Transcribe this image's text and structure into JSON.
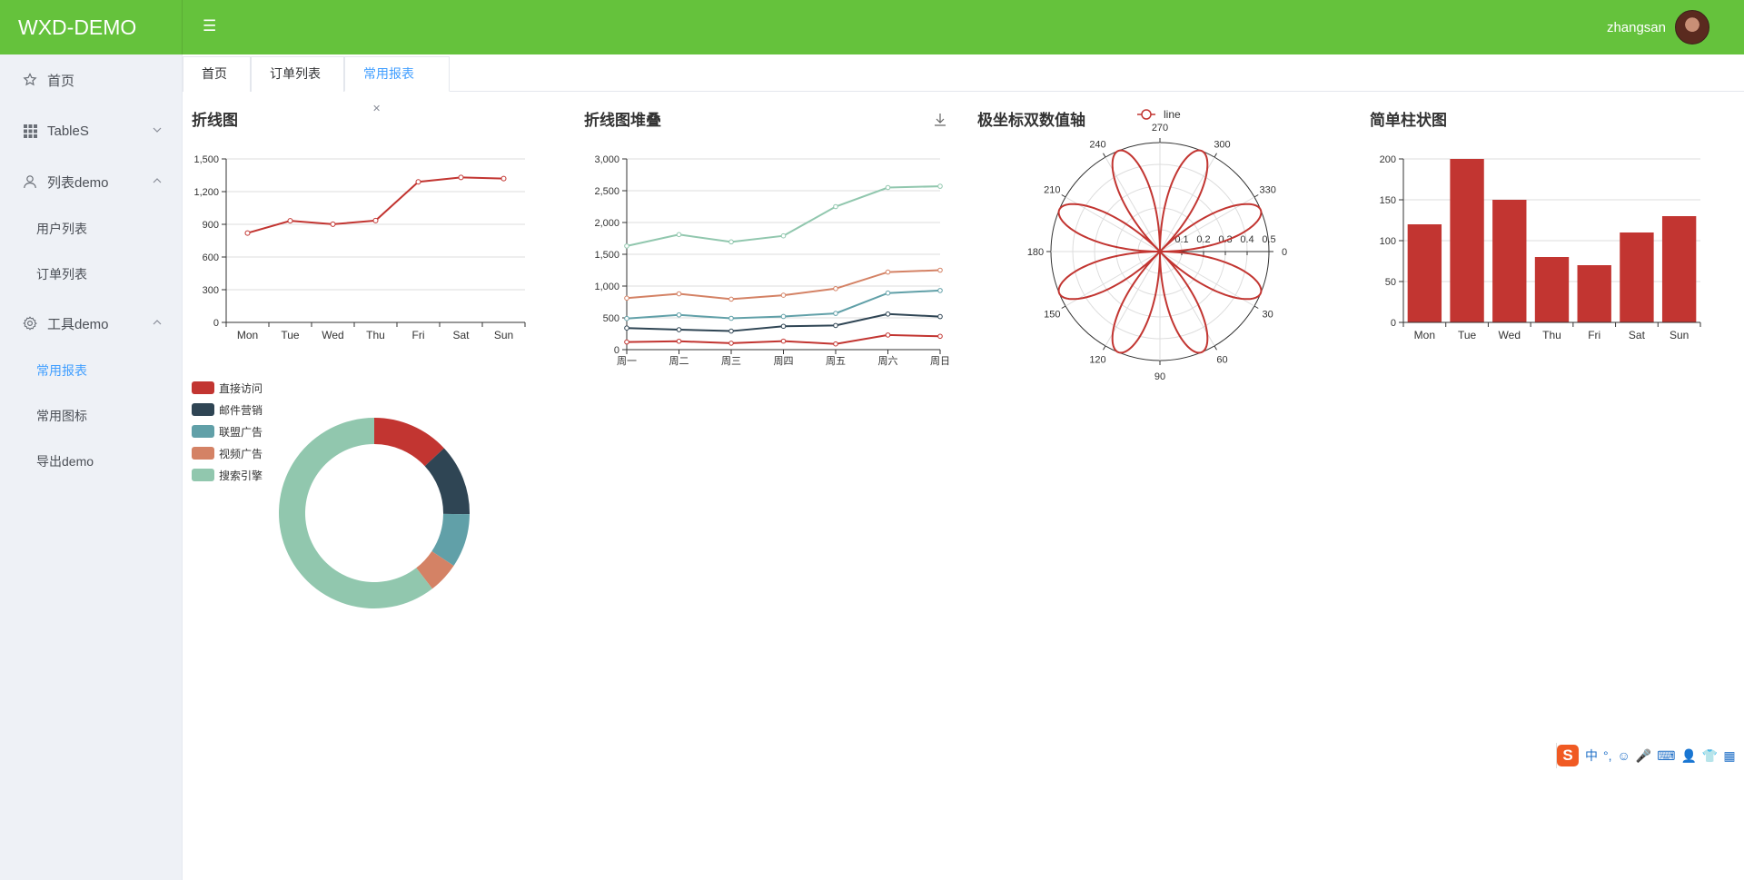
{
  "app": {
    "title": "WXD-DEMO",
    "user": "zhangsan"
  },
  "sidebar": {
    "home": "首页",
    "tables": "TableS",
    "list_demo": "列表demo",
    "list_children": [
      "用户列表",
      "订单列表"
    ],
    "tool_demo": "工具demo",
    "tool_children": [
      "常用报表",
      "常用图标",
      "导出demo"
    ],
    "active": "常用报表"
  },
  "tabs": [
    {
      "label": "首页"
    },
    {
      "label": "订单列表"
    },
    {
      "label": "常用报表",
      "active": true
    }
  ],
  "ime": {
    "items": [
      "中",
      "°,",
      "☺",
      "🎤",
      "⌨",
      "👤",
      "👕",
      "▦"
    ]
  },
  "chart_data": [
    {
      "type": "line",
      "title": "折线图",
      "categories": [
        "Mon",
        "Tue",
        "Wed",
        "Thu",
        "Fri",
        "Sat",
        "Sun"
      ],
      "values": [
        820,
        932,
        901,
        934,
        1290,
        1330,
        1320
      ],
      "ylim": [
        0,
        1500
      ],
      "yticks": [
        "0",
        "300",
        "600",
        "900",
        "1,200",
        "1,500"
      ],
      "color": "#c23531"
    },
    {
      "type": "line",
      "title": "折线图堆叠",
      "stacked": true,
      "categories": [
        "周一",
        "周二",
        "周三",
        "周四",
        "周五",
        "周六",
        "周日"
      ],
      "ylim": [
        0,
        3000
      ],
      "yticks": [
        "0",
        "500",
        "1,000",
        "1,500",
        "2,000",
        "2,500",
        "3,000"
      ],
      "series": [
        {
          "values": [
            120,
            132,
            101,
            134,
            90,
            230,
            210
          ],
          "color": "#c23531"
        },
        {
          "values": [
            220,
            182,
            191,
            234,
            290,
            330,
            310
          ],
          "color": "#2f4554"
        },
        {
          "values": [
            150,
            232,
            201,
            154,
            190,
            330,
            410
          ],
          "color": "#61a0a8"
        },
        {
          "values": [
            320,
            332,
            301,
            334,
            390,
            330,
            320
          ],
          "color": "#d48265"
        },
        {
          "values": [
            820,
            932,
            901,
            934,
            1290,
            1330,
            1320
          ],
          "color": "#91c7ae"
        }
      ],
      "toolbox": "download-icon"
    },
    {
      "type": "polar-line",
      "title": "极坐标双数值轴",
      "legend": [
        "line"
      ],
      "radius_ticks": [
        "0",
        "0.1",
        "0.2",
        "0.3",
        "0.4",
        "0.5"
      ],
      "angle_ticks": [
        "0",
        "30",
        "60",
        "90",
        "120",
        "150",
        "180",
        "210",
        "240",
        "270",
        "300",
        "330"
      ],
      "formula": "r = |sin(2θ)·cos(2θ)| for θ in 0..360°",
      "color": "#c23531"
    },
    {
      "type": "bar",
      "title": "简单柱状图",
      "categories": [
        "Mon",
        "Tue",
        "Wed",
        "Thu",
        "Fri",
        "Sat",
        "Sun"
      ],
      "values": [
        120,
        200,
        150,
        80,
        70,
        110,
        130
      ],
      "ylim": [
        0,
        200
      ],
      "yticks": [
        "0",
        "50",
        "100",
        "150",
        "200"
      ],
      "color": "#c23531"
    },
    {
      "type": "pie",
      "donut": true,
      "legend_position": "top-left",
      "slices": [
        {
          "name": "直接访问",
          "value": 335,
          "color": "#c23531"
        },
        {
          "name": "邮件营销",
          "value": 310,
          "color": "#2f4554"
        },
        {
          "name": "联盟广告",
          "value": 234,
          "color": "#61a0a8"
        },
        {
          "name": "视频广告",
          "value": 135,
          "color": "#d48265"
        },
        {
          "name": "搜索引擎",
          "value": 1548,
          "color": "#91c7ae"
        }
      ]
    }
  ]
}
